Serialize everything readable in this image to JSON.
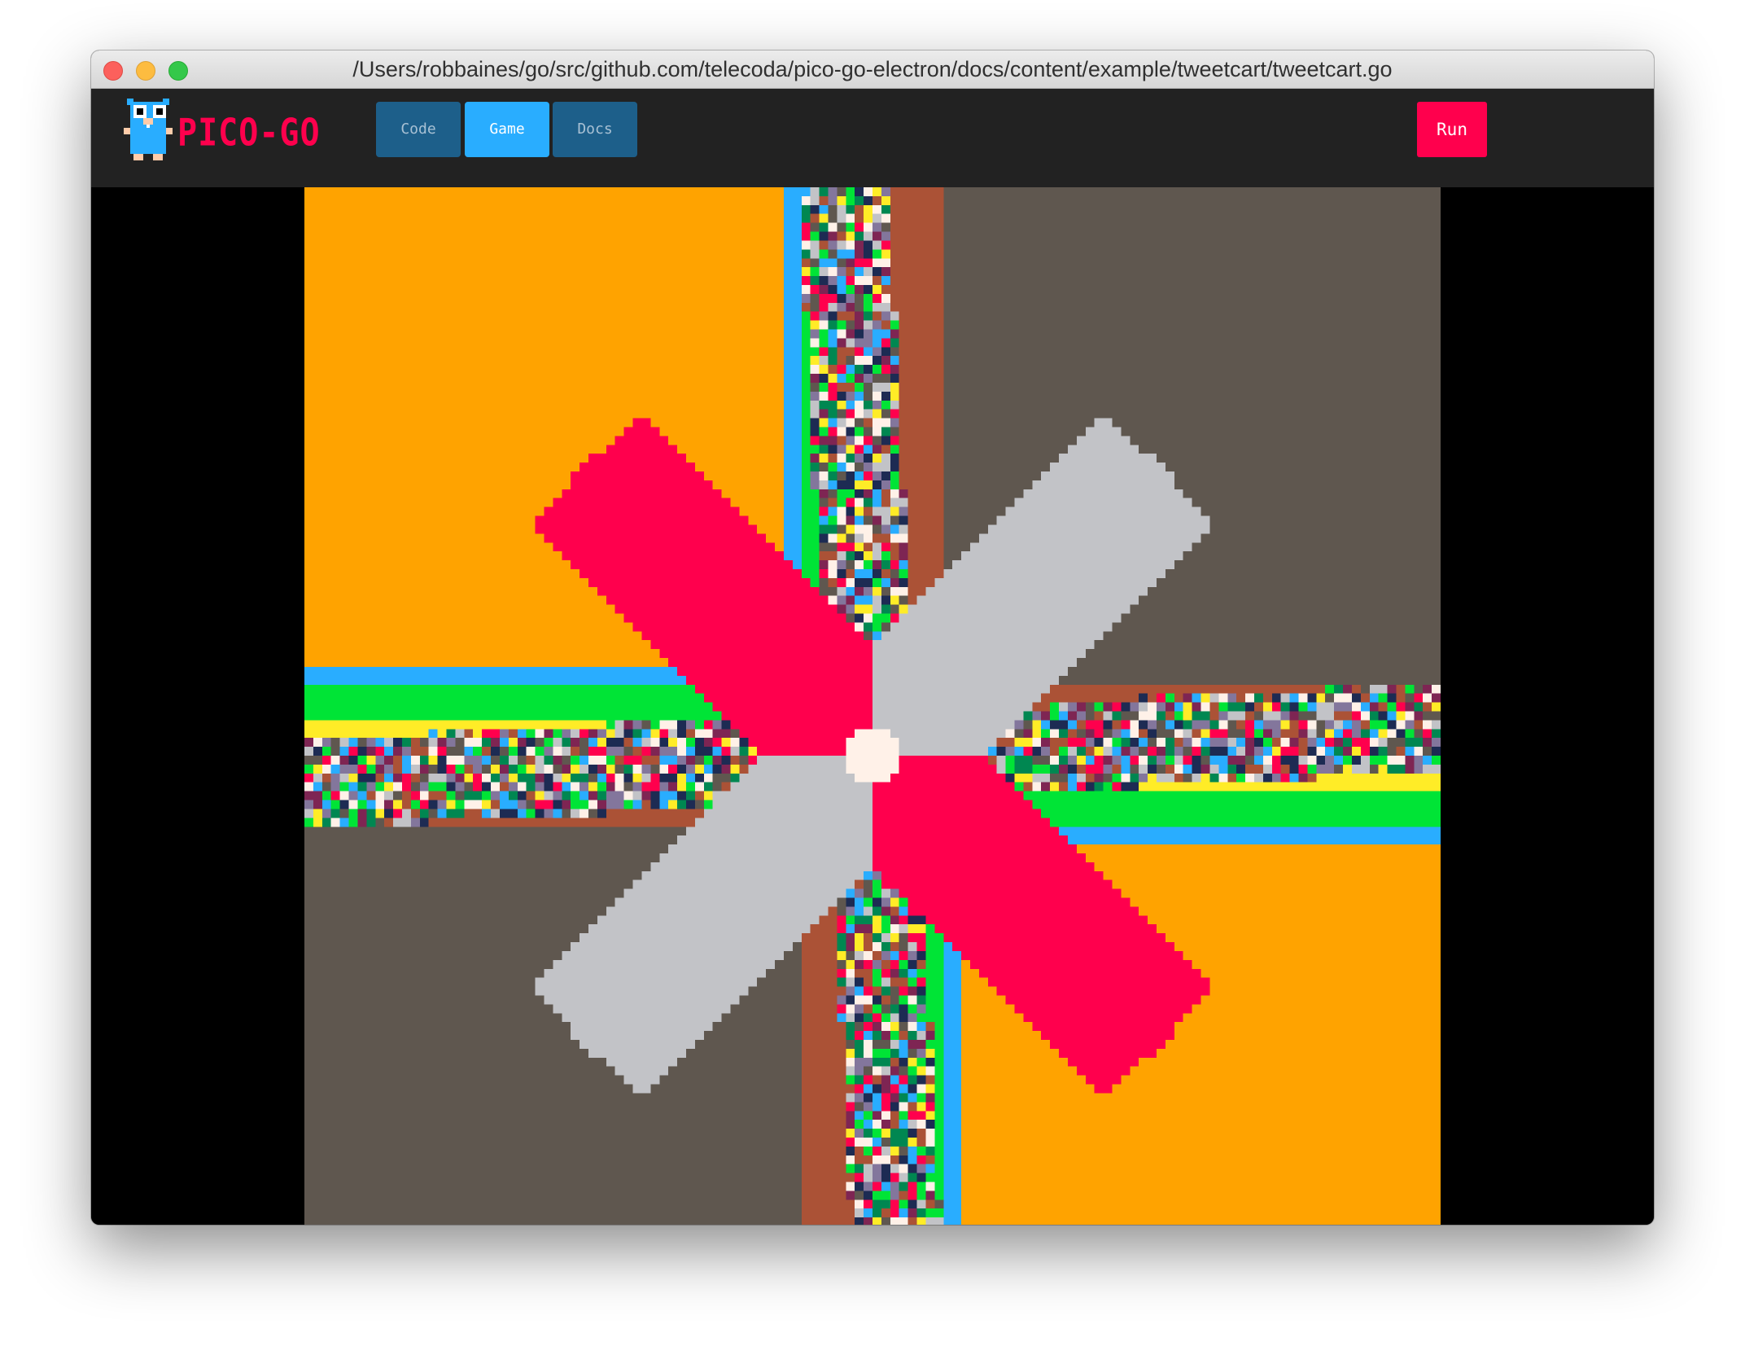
{
  "window": {
    "title": "/Users/robbaines/go/src/github.com/telecoda/pico-go-electron/docs/content/example/tweetcart/tweetcart.go"
  },
  "header": {
    "logo_text": "PICO-GO",
    "tabs": [
      {
        "label": "Code",
        "active": false
      },
      {
        "label": "Game",
        "active": true
      },
      {
        "label": "Docs",
        "active": false
      }
    ],
    "run_label": "Run"
  },
  "game_screen": {
    "palette": {
      "black": "#000000",
      "dark_blue": "#1d2b53",
      "dark_purple": "#7e2553",
      "dark_green": "#008751",
      "brown": "#ab5236",
      "dark_gray": "#5f574f",
      "light_gray": "#c2c3c7",
      "white": "#fff1e8",
      "red": "#ff004d",
      "orange": "#ffa300",
      "yellow": "#ffec27",
      "green": "#00e436",
      "blue": "#29adff",
      "indigo": "#83769c",
      "pink": "#ff77a8",
      "peach": "#ffccaa"
    }
  },
  "colors": {
    "accent": "#29adff",
    "tab_inactive": "#1d5f8a",
    "run": "#ff004d",
    "toolbar": "#222222"
  }
}
